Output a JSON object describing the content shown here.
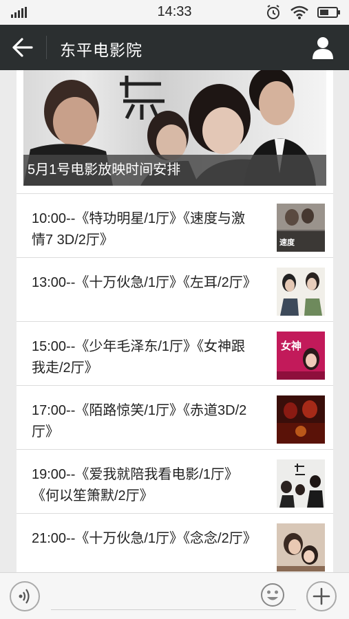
{
  "status_bar": {
    "time": "14:33"
  },
  "header": {
    "title": "东平电影院"
  },
  "banner": {
    "caption": "5月1号电影放映时间安排"
  },
  "schedule": [
    {
      "text": "10:00--《特功明星/1厅》《速度与激情7 3D/2厅》",
      "poster": "fast-furious-poster"
    },
    {
      "text": "13:00--《十万伙急/1厅》《左耳/2厅》",
      "poster": "left-ear-poster"
    },
    {
      "text": "15:00--《少年毛泽东/1厅》《女神跟我走/2厅》",
      "poster": "goddess-poster"
    },
    {
      "text": "17:00--《陌路惊笑/1厅》《赤道3D/2厅》",
      "poster": "equator-poster"
    },
    {
      "text": "19:00--《爱我就陪我看电影/1厅》《何以笙箫默/2厅》",
      "poster": "he-yi-sheng-xiao-mo-poster"
    },
    {
      "text": "21:00--《十万伙急/1厅》《念念/2厅》",
      "poster": "nian-nian-poster"
    }
  ],
  "colors": {
    "titlebar": "#2b2f30",
    "caption_bg": "#464646",
    "accent_poster_pink": "#c21a5a",
    "accent_poster_red": "#8a1a12"
  }
}
